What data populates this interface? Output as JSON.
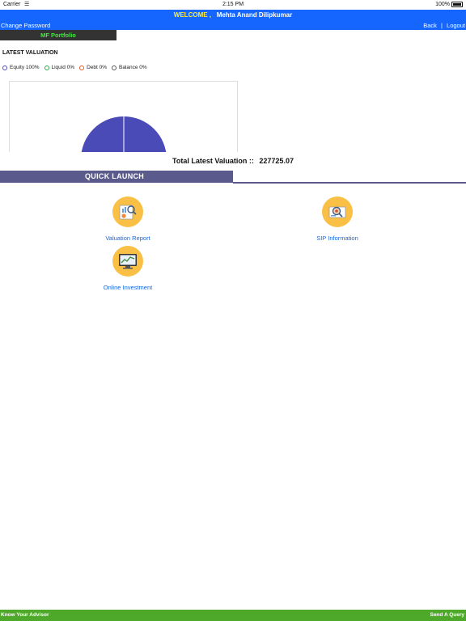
{
  "status_bar": {
    "carrier": "Carrier",
    "time": "2:15 PM",
    "battery": "100%"
  },
  "header": {
    "welcome_label": "WELCOME ,",
    "user_name": "Mehta Anand Dilipkumar"
  },
  "nav": {
    "change_password": "Change Password",
    "back": "Back",
    "separator": "|",
    "logout": "Logout"
  },
  "tab": {
    "label": "MF Portfolio"
  },
  "valuation": {
    "title": "LATEST VALUATION",
    "legend": [
      {
        "label": "Equity 100%",
        "color": "#4b4bb8"
      },
      {
        "label": "Liquid 0%",
        "color": "#2aa84a"
      },
      {
        "label": "Debt 0%",
        "color": "#e05a2a"
      },
      {
        "label": "Balance 0%",
        "color": "#555555"
      }
    ],
    "total_label": "Total Latest Valuation ::",
    "total_value": "227725.07"
  },
  "chart_data": {
    "type": "pie",
    "categories": [
      "Equity",
      "Liquid",
      "Debt",
      "Balance"
    ],
    "values": [
      100,
      0,
      0,
      0
    ],
    "colors": [
      "#4b4bb8",
      "#2aa84a",
      "#e05a2a",
      "#555555"
    ]
  },
  "quick_launch": {
    "title": "QUICK LAUNCH",
    "items": [
      {
        "label": "Valuation Report",
        "icon": "valuation-report-icon"
      },
      {
        "label": "SIP Information",
        "icon": "sip-information-icon"
      },
      {
        "label": "Online Investment",
        "icon": "online-investment-icon"
      }
    ]
  },
  "footer": {
    "left": "Know Your Advisor",
    "right": "Send A Query"
  }
}
